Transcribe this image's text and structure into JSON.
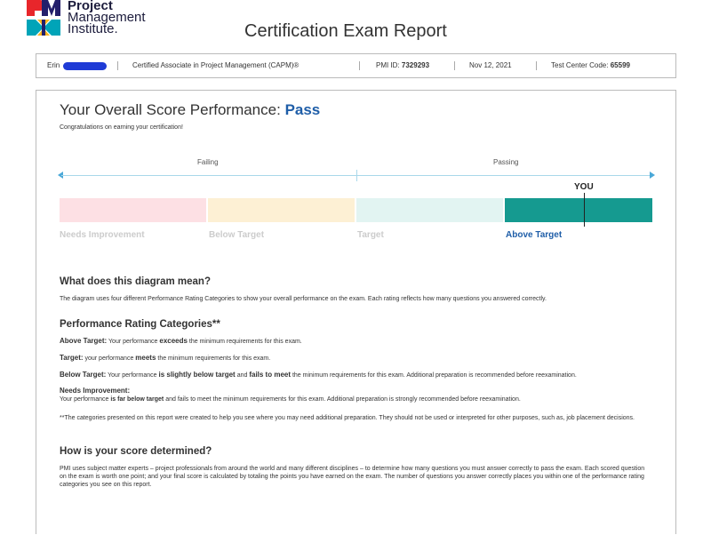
{
  "logo": {
    "line1": "Project",
    "line2": "Management",
    "line3": "Institute."
  },
  "document": {
    "title": "Certification Exam Report"
  },
  "infobar": {
    "candidate_name": "Erin",
    "certification": "Certified Associate in Project Management (CAPM)®",
    "pmi_id_label": "PMI ID:",
    "pmi_id": "7329293",
    "date": "Nov 12, 2021",
    "test_center_label": "Test Center Code:",
    "test_center_code": "65599"
  },
  "score": {
    "heading": "Your Overall Score Performance:",
    "result": "Pass",
    "congrats": "Congratulations on earning your certification!",
    "failing_label": "Failing",
    "passing_label": "Passing",
    "you_label": "YOU",
    "categories": [
      "Needs Improvement",
      "Below Target",
      "Target",
      "Above Target"
    ],
    "active_category": "Above Target",
    "colors": {
      "needs_improvement": "#fde0e4",
      "below_target": "#fdf0d4",
      "target": "#e2f4f2",
      "above_target": "#159a90",
      "accent": "#1f5ea8"
    }
  },
  "diagram": {
    "heading": "What does this diagram mean?",
    "text": "The diagram uses four different Performance Rating Categories to show your overall performance on the exam. Each rating reflects how many questions you answered correctly."
  },
  "ratings": {
    "heading": "Performance Rating Categories**",
    "above_label": "Above Target:",
    "above_pre": "Your performance",
    "above_bold": "exceeds",
    "above_post": "the minimum requirements for this exam.",
    "target_label": "Target:",
    "target_pre": "your performance",
    "target_bold": "meets",
    "target_post": "the minimum requirements for this exam.",
    "below_label": "Below Target:",
    "below_pre": "Your performance",
    "below_bold1": "is slightly below target",
    "below_mid": "and",
    "below_bold2": "fails to meet",
    "below_post": "the minimum requirements for this exam. Additional preparation is recommended before reexamination.",
    "needs_label": "Needs Improvement:",
    "needs_pre": "Your performance",
    "needs_bold": "is far below target",
    "needs_post": "and fails to meet the minimum requirements for this exam. Additional preparation is strongly recommended before reexamination.",
    "footnote": "**The categories presented on this report were created to help you see where you may need additional preparation. They should not be used or interpreted for other purposes, such as, job placement decisions."
  },
  "determined": {
    "heading": "How is your score determined?",
    "text": "PMI uses subject matter experts – project professionals from around the world and many different disciplines – to determine how many questions you must answer correctly to pass the exam. Each scored question on the exam is worth one point; and your final score is calculated by totaling the points you have earned on the exam. The number of questions you answer correctly places you within one of the performance rating categories you see on this report."
  }
}
